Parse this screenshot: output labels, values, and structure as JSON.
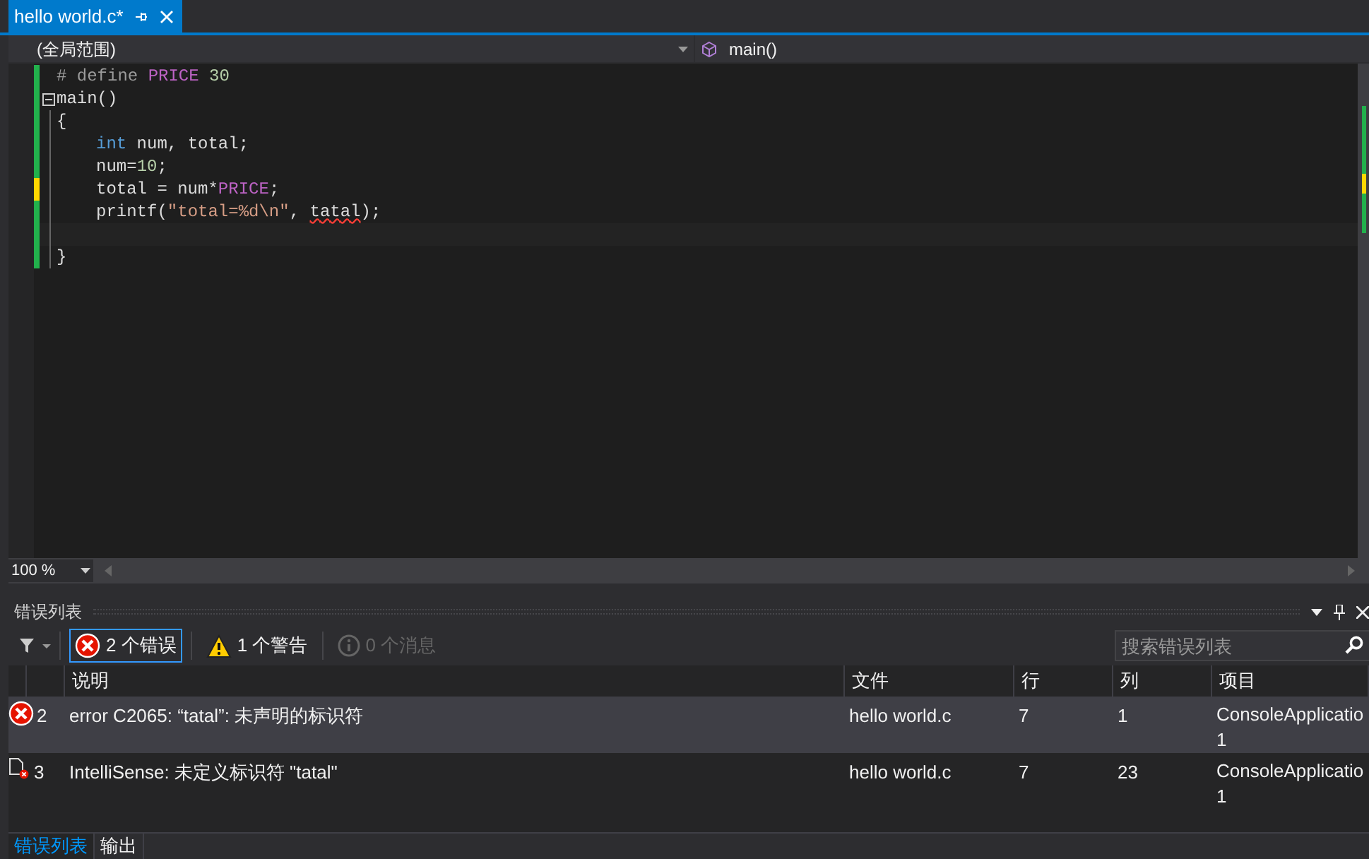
{
  "document_tab": {
    "title": "hello world.c*",
    "selected": true
  },
  "nav_bar": {
    "scope": "(全局范围)",
    "member": "main()"
  },
  "code_lines": [
    {
      "unsaved": false,
      "tokens": [
        {
          "text": "# define ",
          "kind": "preproc"
        },
        {
          "text": "PRICE",
          "kind": "macro"
        },
        {
          "text": " 30",
          "kind": "number"
        }
      ]
    },
    {
      "unsaved": false,
      "fold": true,
      "tokens": [
        {
          "text": "main()",
          "kind": "plain"
        }
      ]
    },
    {
      "unsaved": false,
      "tokens": [
        {
          "text": "{",
          "kind": "plain"
        }
      ]
    },
    {
      "unsaved": false,
      "indented": true,
      "tokens": [
        {
          "text": "int",
          "kind": "keyword"
        },
        {
          "text": " num, total;",
          "kind": "plain"
        }
      ]
    },
    {
      "unsaved": false,
      "indented": true,
      "tokens": [
        {
          "text": "num=",
          "kind": "plain"
        },
        {
          "text": "10",
          "kind": "number"
        },
        {
          "text": ";",
          "kind": "plain"
        }
      ]
    },
    {
      "unsaved": true,
      "indented": true,
      "tokens": [
        {
          "text": "total = num*",
          "kind": "plain"
        },
        {
          "text": "PRICE",
          "kind": "macro"
        },
        {
          "text": ";",
          "kind": "plain"
        }
      ]
    },
    {
      "unsaved": false,
      "indented": true,
      "tokens": [
        {
          "text": "printf(",
          "kind": "plain"
        },
        {
          "text": "\"total=%d\\n\"",
          "kind": "string"
        },
        {
          "text": ", ",
          "kind": "plain"
        },
        {
          "text": "tatal",
          "kind": "error"
        },
        {
          "text": ");",
          "kind": "plain"
        }
      ]
    },
    {
      "unsaved": false
    },
    {
      "unsaved": false,
      "tokens": [
        {
          "text": "}",
          "kind": "plain"
        }
      ]
    }
  ],
  "zoom": "100 %",
  "error_list": {
    "title": "错误列表",
    "filters": [
      {
        "kind": "error",
        "label": "2 个错误",
        "selected": true,
        "disabled": false
      },
      {
        "kind": "warning",
        "label": "1 个警告",
        "selected": false,
        "disabled": false
      },
      {
        "kind": "info",
        "label": "0 个消息",
        "selected": false,
        "disabled": true
      }
    ],
    "search": {
      "placeholder": "搜索错误列表"
    },
    "columns": [
      "说明",
      "文件",
      "行",
      "列",
      "项目"
    ],
    "rows": [
      {
        "kind": "error",
        "number": "2",
        "description": "error C2065: “tatal”: 未声明的标识符",
        "file": "hello world.c",
        "line": "7",
        "column": "1",
        "project_lines": [
          "ConsoleApplicatio",
          "1"
        ],
        "selected": true
      },
      {
        "kind": "intellisense",
        "number": "3",
        "description": "IntelliSense:  未定义标识符 \"tatal\"",
        "file": "hello world.c",
        "line": "7",
        "column": "23",
        "project_lines": [
          "ConsoleApplicatio",
          "1"
        ],
        "selected": false
      }
    ]
  },
  "bottom_tabs": [
    {
      "label": "错误列表",
      "selected": true
    },
    {
      "label": "输出",
      "selected": false
    }
  ]
}
